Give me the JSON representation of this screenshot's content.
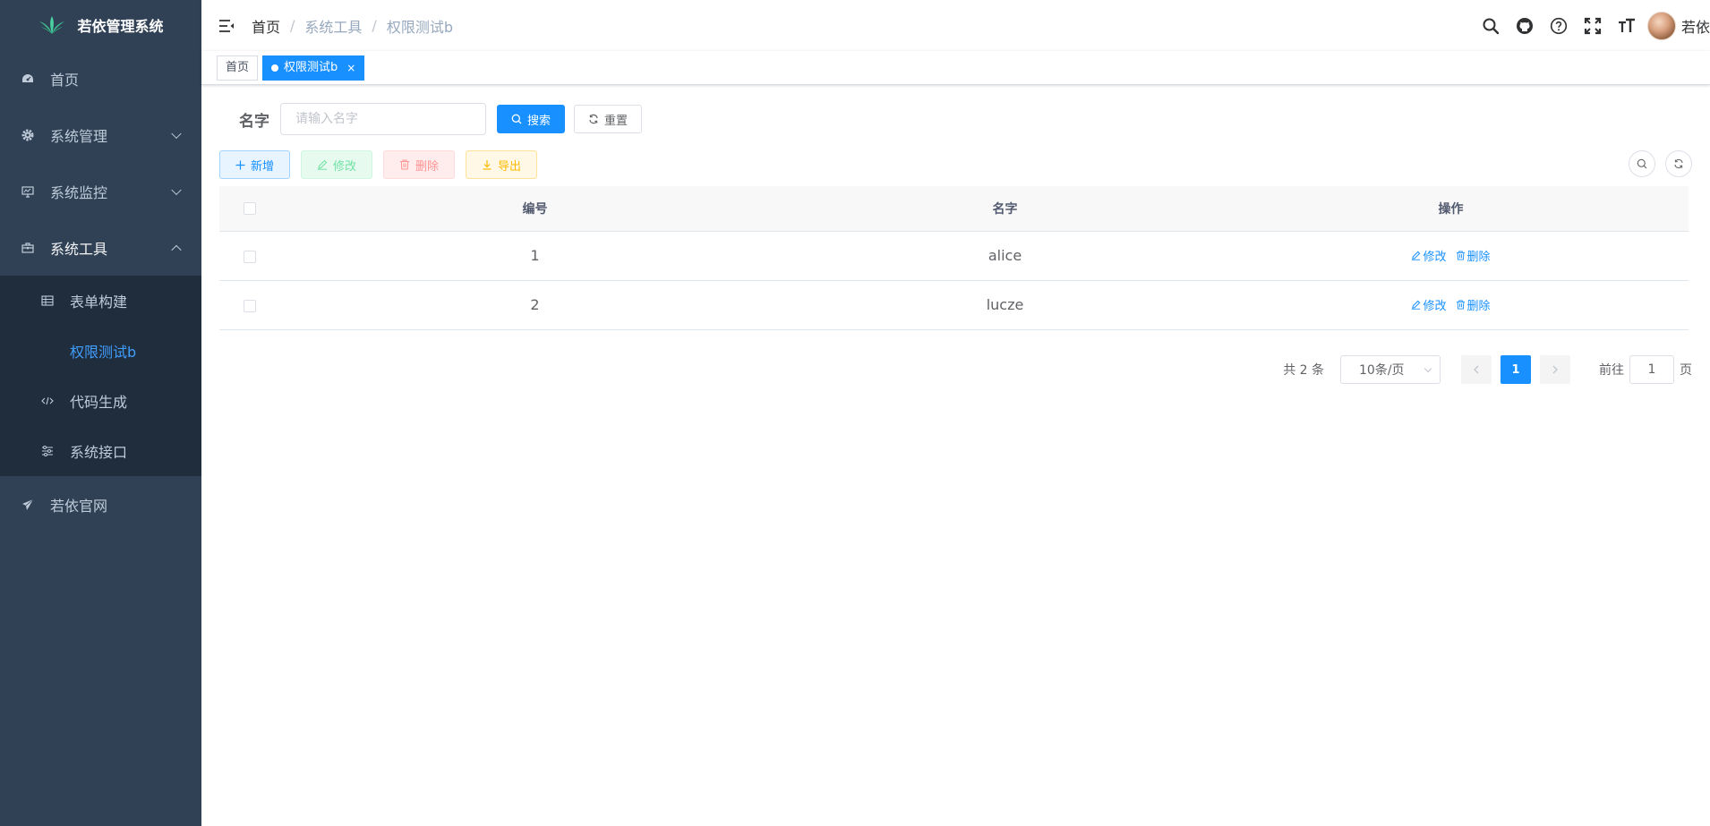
{
  "app": {
    "title": "若依管理系统"
  },
  "sidebar": {
    "items": [
      {
        "label": "首页",
        "icon": "dashboard-icon"
      },
      {
        "label": "系统管理",
        "icon": "gear-icon"
      },
      {
        "label": "系统监控",
        "icon": "monitor-icon"
      },
      {
        "label": "系统工具",
        "icon": "toolbox-icon"
      },
      {
        "label": "若依官网",
        "icon": "paper-plane-icon"
      }
    ],
    "tools_submenu": [
      {
        "label": "表单构建",
        "icon": "table-icon"
      },
      {
        "label": "权限测试b",
        "icon": "",
        "active": true
      },
      {
        "label": "代码生成",
        "icon": "code-icon"
      },
      {
        "label": "系统接口",
        "icon": "sliders-icon"
      }
    ]
  },
  "navbar": {
    "breadcrumb": [
      "首页",
      "系统工具",
      "权限测试b"
    ],
    "separator": "/",
    "username": "若依"
  },
  "tags": [
    {
      "label": "首页",
      "active": false
    },
    {
      "label": "权限测试b",
      "active": true,
      "close": "×"
    }
  ],
  "search": {
    "label": "名字",
    "placeholder": "请输入名字",
    "search_btn": "搜索",
    "reset_btn": "重置"
  },
  "toolbar": {
    "add": "新增",
    "edit": "修改",
    "delete": "删除",
    "export": "导出"
  },
  "table": {
    "headers": [
      "编号",
      "名字",
      "操作"
    ],
    "rows": [
      {
        "id": "1",
        "name": "alice",
        "edit": "修改",
        "delete": "删除"
      },
      {
        "id": "2",
        "name": "lucze",
        "edit": "修改",
        "delete": "删除"
      }
    ]
  },
  "pagination": {
    "total": "共 2 条",
    "page_size": "10条/页",
    "current": "1",
    "goto_prefix": "前往",
    "goto_value": "1",
    "goto_suffix": "页"
  },
  "colors": {
    "sidebar_bg": "#304156",
    "submenu_bg": "#1f2d3d",
    "primary": "#1890ff"
  }
}
